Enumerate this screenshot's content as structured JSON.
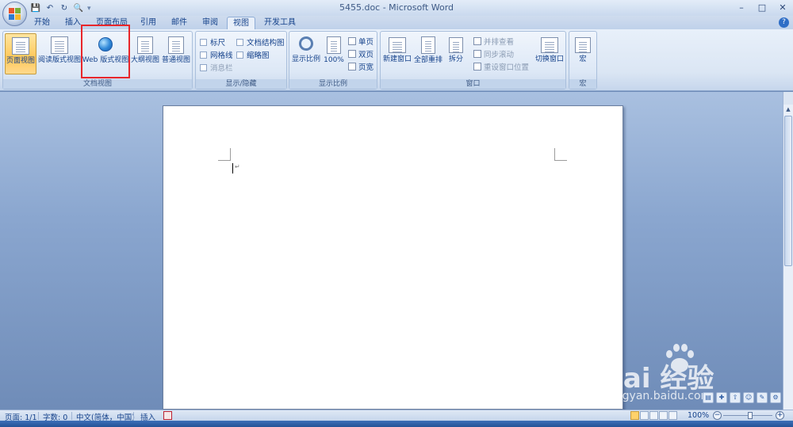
{
  "window": {
    "title": "5455.doc - Microsoft Word",
    "controls": [
      "–",
      "□",
      "✕"
    ],
    "help": "?"
  },
  "qat": {
    "save": "💾",
    "undo": "↶",
    "redo": "↻",
    "preview": "🔍",
    "more": "▾"
  },
  "tabs": [
    {
      "label": "开始",
      "active": false
    },
    {
      "label": "插入",
      "active": false
    },
    {
      "label": "页面布局",
      "active": false
    },
    {
      "label": "引用",
      "active": false
    },
    {
      "label": "邮件",
      "active": false
    },
    {
      "label": "审阅",
      "active": false
    },
    {
      "label": "视图",
      "active": true
    },
    {
      "label": "开发工具",
      "active": false
    }
  ],
  "ribbon": {
    "doc_views": {
      "label": "文档视图",
      "print_layout": "页面视图",
      "full_screen_reading": "阅读版式视图",
      "web_layout": "Web 版式视图",
      "outline": "大纲视图",
      "draft": "普通视图"
    },
    "show_hide": {
      "label": "显示/隐藏",
      "ruler": "标尺",
      "gridlines": "网格线",
      "message_bar": "消息栏",
      "document_map": "文档结构图",
      "thumbnails": "缩略图"
    },
    "zoom": {
      "label": "显示比例",
      "zoom": "显示比例",
      "percent": "100%",
      "one_page": "单页",
      "two_pages": "双页",
      "page_width": "页宽"
    },
    "window": {
      "label": "窗口",
      "new_window": "新建窗口",
      "arrange_all": "全部重排",
      "split": "拆分",
      "side_by_side": "并排查看",
      "sync_scroll": "同步滚动",
      "reset_position": "重设窗口位置",
      "switch_windows": "切换窗口"
    },
    "macros": {
      "label": "宏",
      "macros": "宏"
    }
  },
  "status": {
    "page": "页面: 1/1",
    "words": "字数: 0",
    "language": "中文(简体，中国)",
    "insert_mode": "插入",
    "zoom": "100%"
  },
  "watermark": {
    "brand": "Bai  经验",
    "url": "jingyan.baidu.com"
  }
}
